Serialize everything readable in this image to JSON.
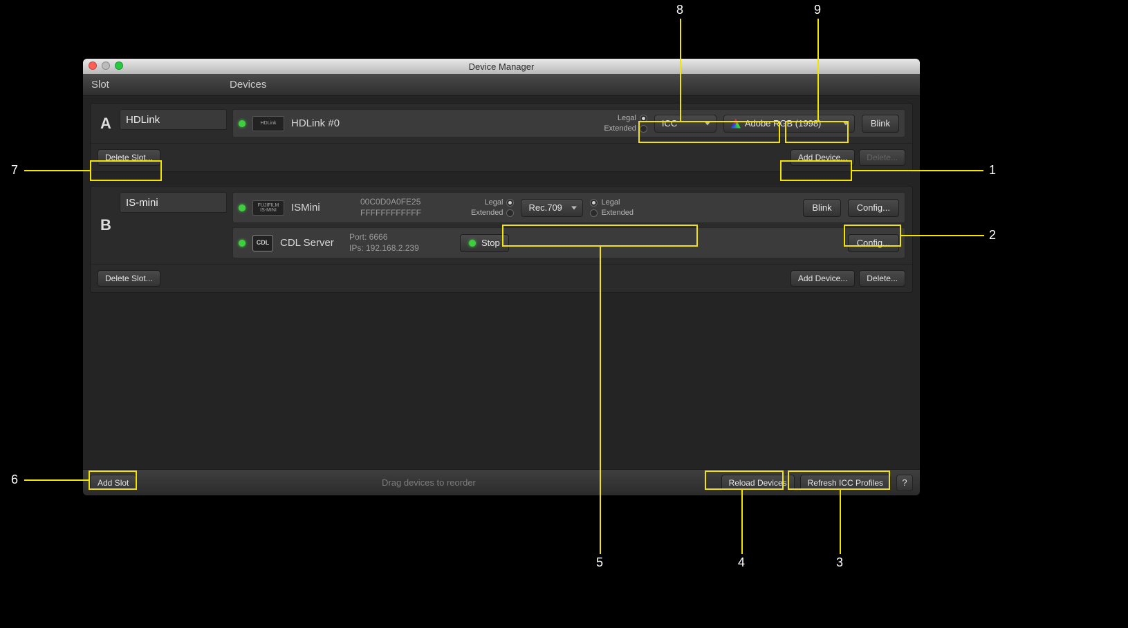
{
  "window": {
    "title": "Device Manager"
  },
  "header": {
    "slot": "Slot",
    "devices": "Devices"
  },
  "radio_labels": {
    "legal": "Legal",
    "extended": "Extended"
  },
  "slots": [
    {
      "letter": "A",
      "name": "HDLink",
      "devices": [
        {
          "kind": "hdlink",
          "status": "green",
          "icon_label": "HDLink",
          "name": "HDLink #0",
          "left_range_selected": "legal",
          "mode_select": "ICC",
          "profile_select": "Adobe RGB (1998)",
          "blink_label": "Blink"
        }
      ],
      "footer": {
        "delete_slot": "Delete Slot...",
        "add_device": "Add Device...",
        "delete": "Delete...",
        "delete_enabled": false
      }
    },
    {
      "letter": "B",
      "name": "IS-mini",
      "devices": [
        {
          "kind": "ismini",
          "status": "green",
          "icon_label_top": "FUJIFILM",
          "icon_label_bot": "IS-MINI",
          "name": "ISMini",
          "info_line1": "00C0D0A0FE25",
          "info_line2": "FFFFFFFFFFFF",
          "left_range_selected": "legal",
          "mode_select": "Rec.709",
          "right_range_selected": "legal",
          "blink_label": "Blink",
          "config_label": "Config..."
        },
        {
          "kind": "cdl",
          "status": "green",
          "icon_label": "CDL",
          "name": "CDL Server",
          "info_line1": "Port: 6666",
          "info_line2": "IPs: 192.168.2.239",
          "stop_label": "Stop",
          "config_label": "Config..."
        }
      ],
      "footer": {
        "delete_slot": "Delete Slot...",
        "add_device": "Add Device...",
        "delete": "Delete...",
        "delete_enabled": true
      }
    }
  ],
  "footer": {
    "add_slot": "Add Slot",
    "hint": "Drag devices to reorder",
    "reload_devices": "Reload Devices",
    "refresh_icc": "Refresh ICC Profiles",
    "help": "?"
  },
  "annotations": {
    "1": "1",
    "2": "2",
    "3": "3",
    "4": "4",
    "5": "5",
    "6": "6",
    "7": "7",
    "8": "8",
    "9": "9"
  }
}
